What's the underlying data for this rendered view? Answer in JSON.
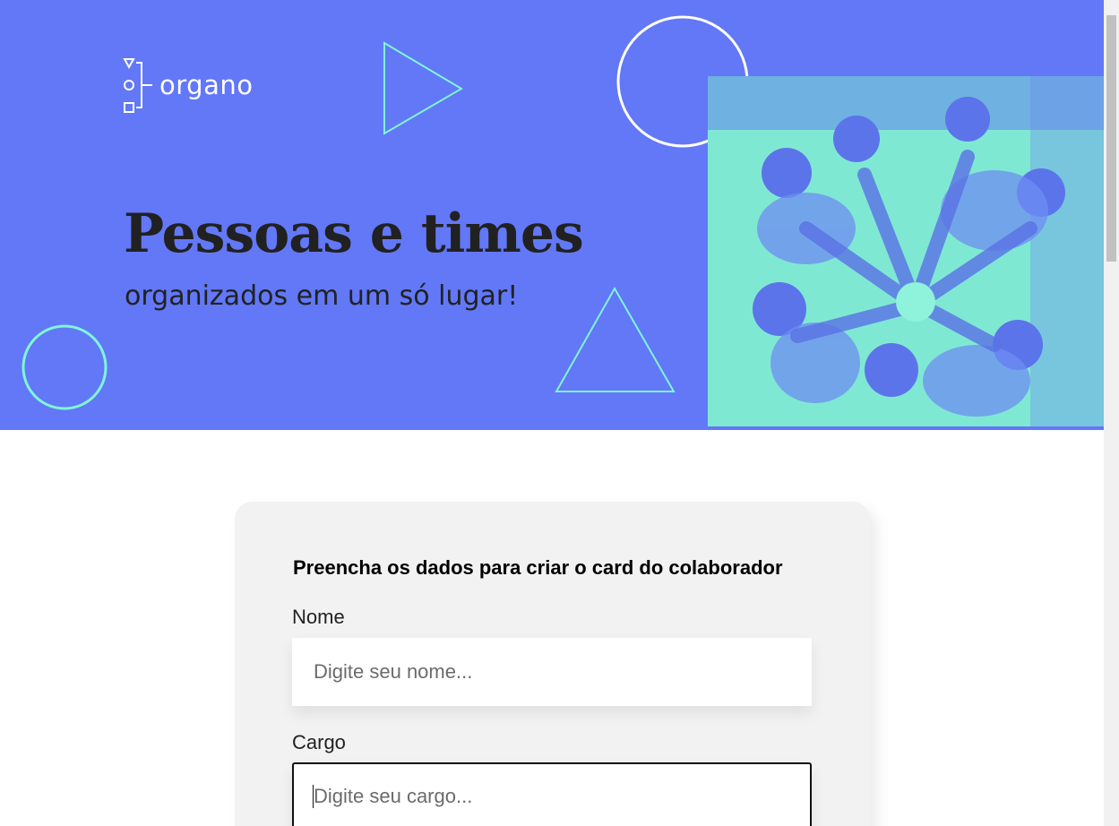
{
  "brand": {
    "name": "organo",
    "icon": "org-chart-logo-icon"
  },
  "hero": {
    "title": "Pessoas e times",
    "subtitle": "organizados em um só lugar!",
    "image": "team-hands-photo",
    "colors": {
      "background": "#6278f7",
      "accent": "#7ff5d6"
    }
  },
  "form": {
    "title": "Preencha os dados para criar o card do colaborador",
    "fields": [
      {
        "label": "Nome",
        "placeholder": "Digite seu nome...",
        "value": ""
      },
      {
        "label": "Cargo",
        "placeholder": "Digite seu cargo...",
        "value": ""
      }
    ]
  }
}
